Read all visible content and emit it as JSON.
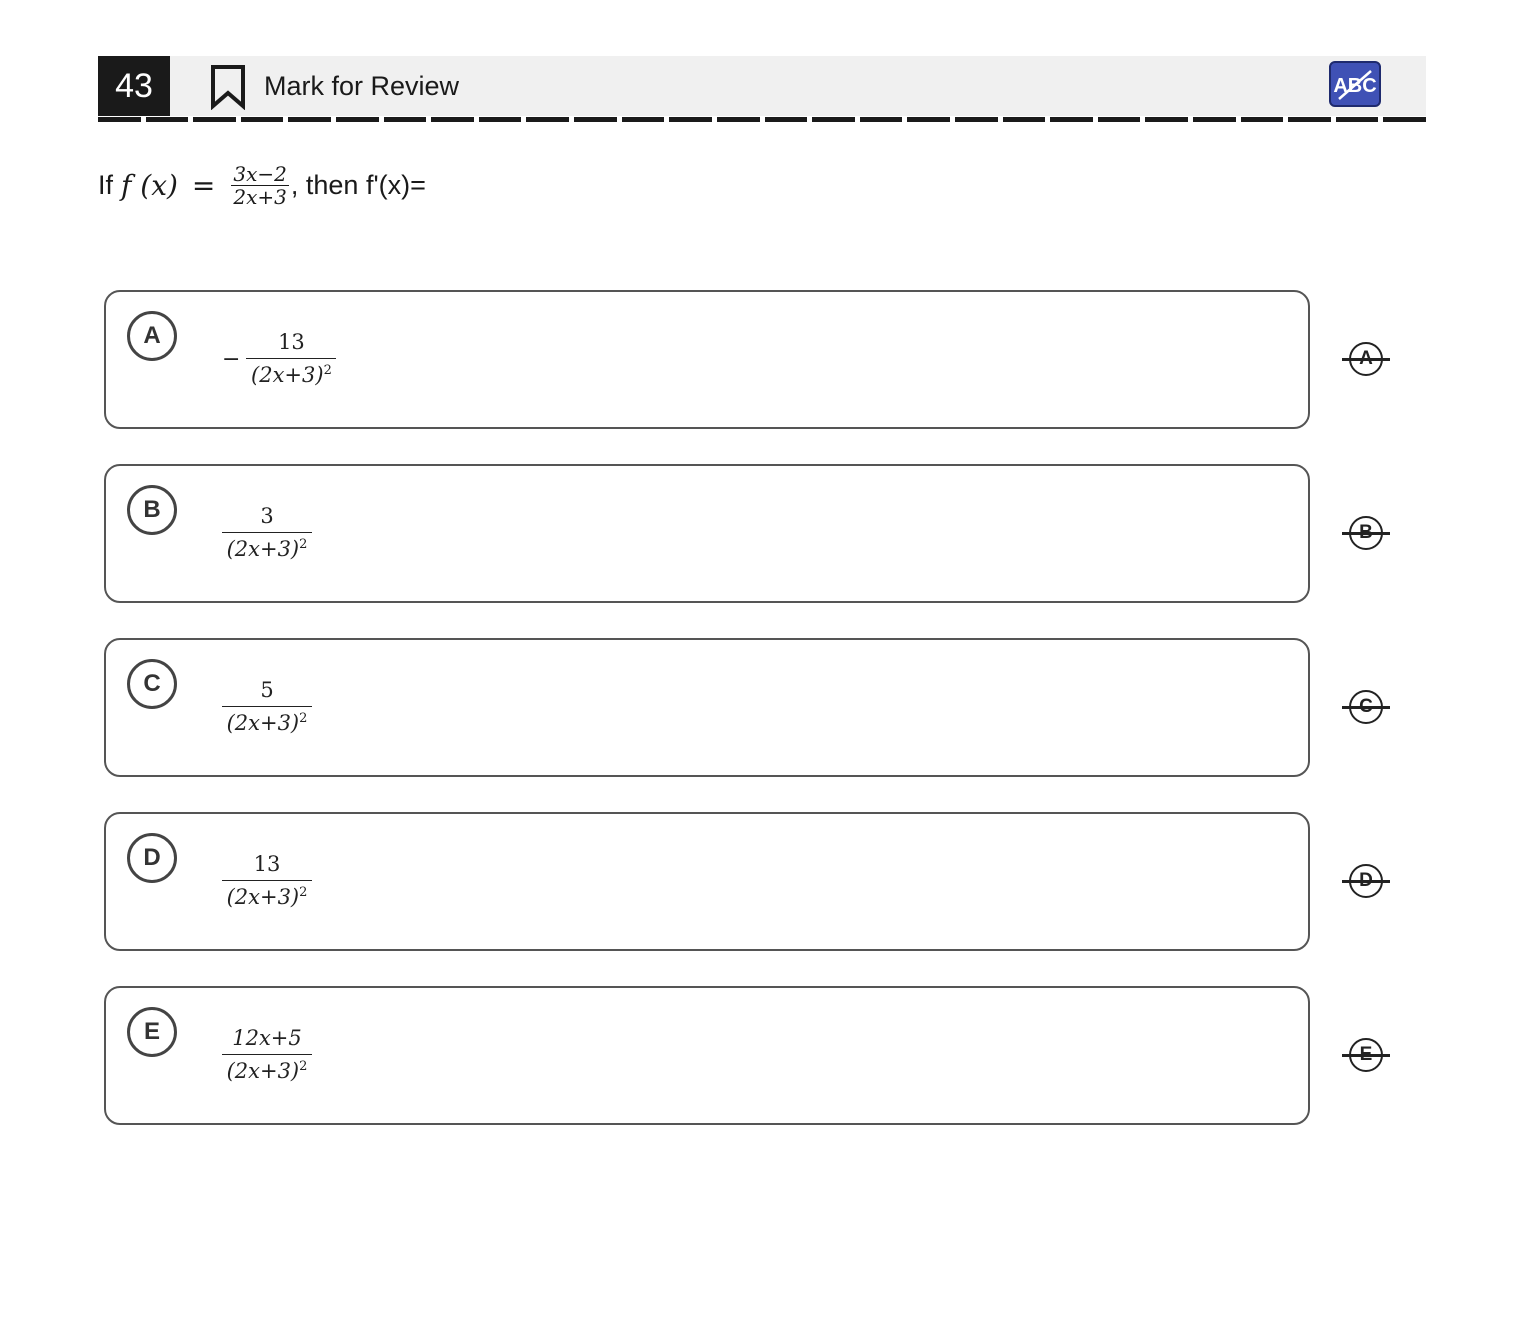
{
  "header": {
    "question_number": "43",
    "mark_for_review_label": "Mark for Review",
    "answer_eliminator_icon": "abc-strikethrough-icon",
    "accent_color": "#3f51b5"
  },
  "question": {
    "prefix": "If",
    "function_lhs": "f (x)",
    "equals": "=",
    "numerator": "3x−2",
    "denominator": "2x+3",
    "suffix": ", then f'(x)="
  },
  "choices": [
    {
      "letter": "A",
      "sign": "−",
      "numerator": "13",
      "denominator": "(2x+3)",
      "exponent": "2"
    },
    {
      "letter": "B",
      "sign": "",
      "numerator": "3",
      "denominator": "(2x+3)",
      "exponent": "2"
    },
    {
      "letter": "C",
      "sign": "",
      "numerator": "5",
      "denominator": "(2x+3)",
      "exponent": "2"
    },
    {
      "letter": "D",
      "sign": "",
      "numerator": "13",
      "denominator": "(2x+3)",
      "exponent": "2"
    },
    {
      "letter": "E",
      "sign": "",
      "numerator": "12x+5",
      "denominator": "(2x+3)",
      "exponent": "2"
    }
  ]
}
